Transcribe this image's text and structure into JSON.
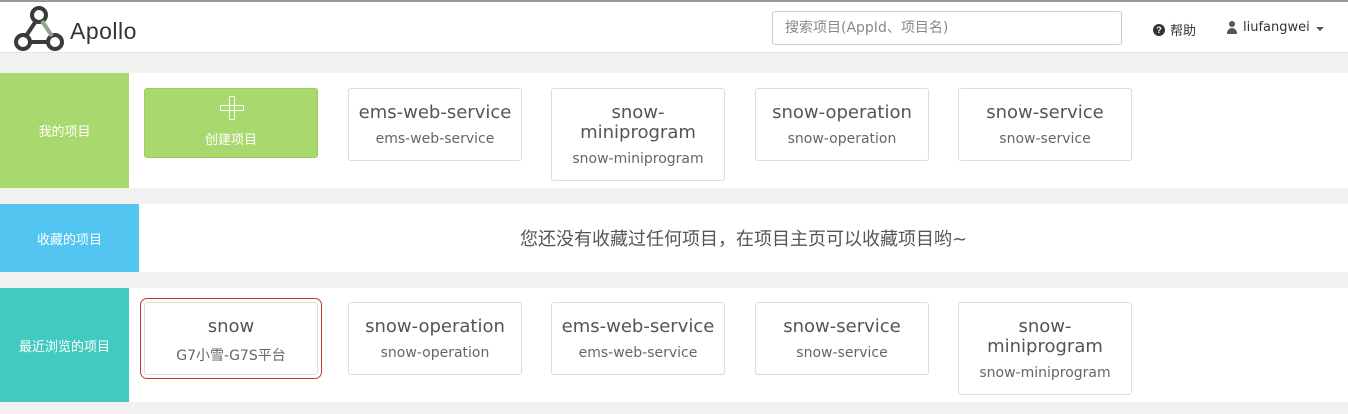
{
  "header": {
    "app_name": "Apollo",
    "search_placeholder": "搜索项目(AppId、项目名)",
    "help_label": "帮助",
    "username": "liufangwei"
  },
  "my_projects": {
    "label": "我的项目",
    "create_label": "创建项目",
    "items": [
      {
        "name": "ems-web-service",
        "appid": "ems-web-service"
      },
      {
        "name": "snow-miniprogram",
        "appid": "snow-miniprogram"
      },
      {
        "name": "snow-operation",
        "appid": "snow-operation"
      },
      {
        "name": "snow-service",
        "appid": "snow-service"
      }
    ]
  },
  "favorites": {
    "label": "收藏的项目",
    "empty_message": "您还没有收藏过任何项目，在项目主页可以收藏项目哟~"
  },
  "recent": {
    "label": "最近浏览的项目",
    "items": [
      {
        "name": "snow",
        "appid": "G7小雪-G7S平台"
      },
      {
        "name": "snow-operation",
        "appid": "snow-operation"
      },
      {
        "name": "ems-web-service",
        "appid": "ems-web-service"
      },
      {
        "name": "snow-service",
        "appid": "snow-service"
      },
      {
        "name": "snow-miniprogram",
        "appid": "snow-miniprogram"
      }
    ]
  },
  "colors": {
    "my_projects_accent": "#a9d86e",
    "favorites_accent": "#52c6f0",
    "recent_accent": "#41cac0",
    "selected_border": "#c0392b"
  }
}
